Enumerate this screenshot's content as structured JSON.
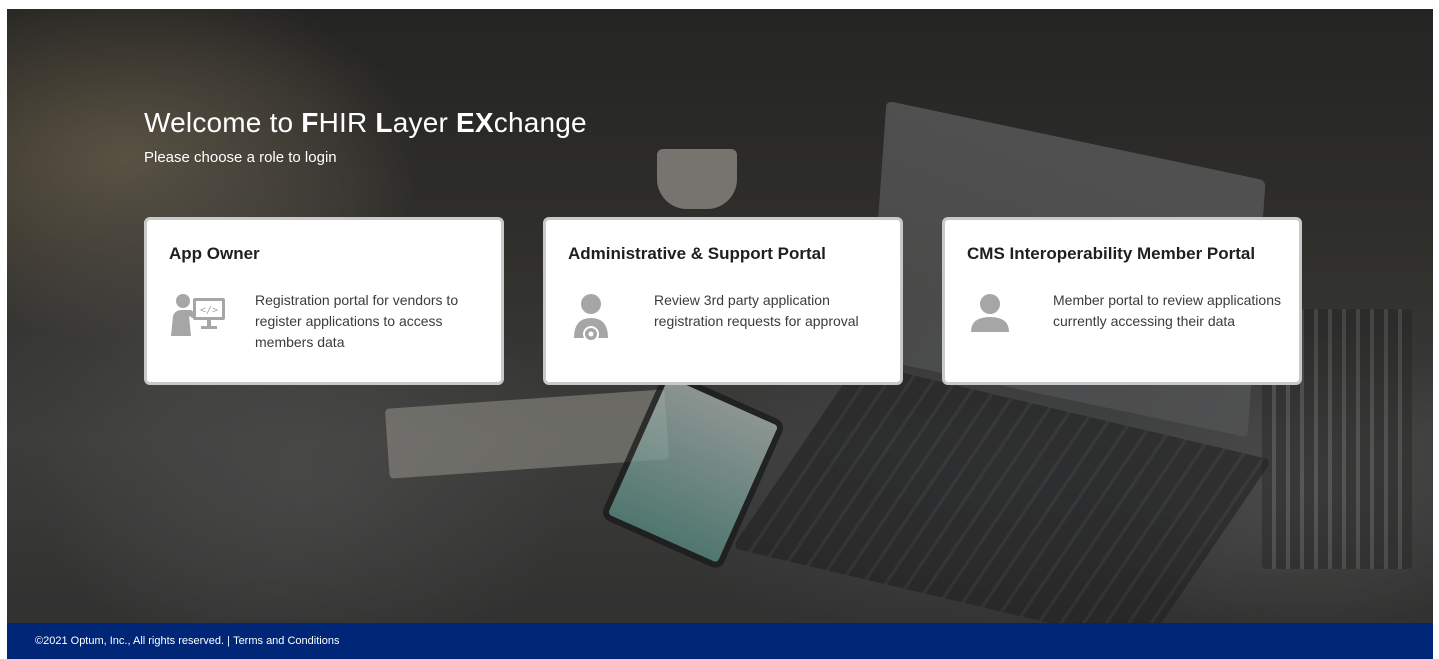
{
  "welcome": {
    "prefix": "Welcome to ",
    "f_bold": "F",
    "f_rest": "HIR ",
    "l_bold": "L",
    "l_rest": "ayer ",
    "ex_bold": "EX",
    "ex_rest": "change",
    "subtitle": "Please choose a role to login"
  },
  "cards": [
    {
      "title": "App Owner",
      "icon": "developer-presentation-icon",
      "description": "Registration portal for vendors to register applications to access members data"
    },
    {
      "title": "Administrative & Support Portal",
      "icon": "user-gear-icon",
      "description": "Review 3rd party application registration requests for approval"
    },
    {
      "title": "CMS Interoperability Member Portal",
      "icon": "user-icon",
      "description": "Member portal to review applications currently accessing their data"
    }
  ],
  "footer": {
    "copyright": "©2021 Optum, Inc., All rights reserved. | ",
    "terms_link": "Terms and Conditions"
  },
  "colors": {
    "footer_bg": "#002677",
    "icon_gray": "#a6a6a6",
    "card_border": "#c9c9c9"
  }
}
